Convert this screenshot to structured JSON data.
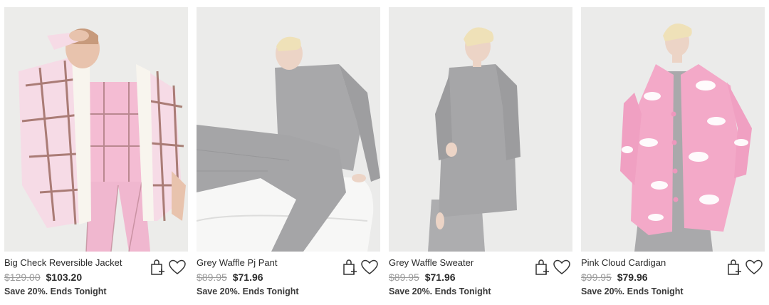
{
  "products": [
    {
      "name": "Big Check Reversible Jacket",
      "was_price": "$129.00",
      "now_price": "$103.20",
      "promo": "Save 20%. Ends Tonight",
      "image_alt": "Model in pink check reversible jacket with sherpa lining"
    },
    {
      "name": "Grey Waffle Pj Pant",
      "was_price": "$89.95",
      "now_price": "$71.96",
      "promo": "Save 20%. Ends Tonight",
      "image_alt": "Model in grey waffle pajama pant sitting on pillow"
    },
    {
      "name": "Grey Waffle Sweater",
      "was_price": "$89.95",
      "now_price": "$71.96",
      "promo": "Save 20%. Ends Tonight",
      "image_alt": "Model in grey waffle sweater"
    },
    {
      "name": "Pink Cloud Cardigan",
      "was_price": "$99.95",
      "now_price": "$79.96",
      "promo": "Save 20%. Ends Tonight",
      "image_alt": "Model in pink cardigan with white cloud pattern"
    }
  ],
  "icons": {
    "add_to_bag": "add-to-bag-icon",
    "wishlist": "heart-icon"
  },
  "colors": {
    "photo_background": "#e9e9e8",
    "text": "#2b2b2b",
    "strikethrough": "#9a9a9a",
    "pink": "#f2a9c8",
    "grey_knit": "#a9a9ab"
  }
}
